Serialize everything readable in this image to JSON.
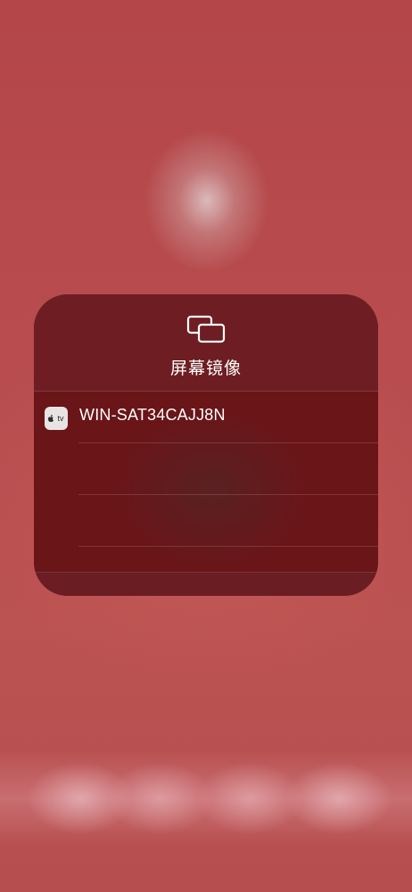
{
  "screen_mirroring": {
    "title": "屏幕镜像",
    "icon": "screen-mirroring-icon",
    "devices": [
      {
        "name": "WIN-SAT34CAJJ8N",
        "icon": "apple-tv-icon",
        "icon_text": "tv"
      }
    ]
  },
  "colors": {
    "background": "#b3474a",
    "panel": "#6c1f24",
    "list": "#6a1518",
    "text": "#ffffff"
  }
}
